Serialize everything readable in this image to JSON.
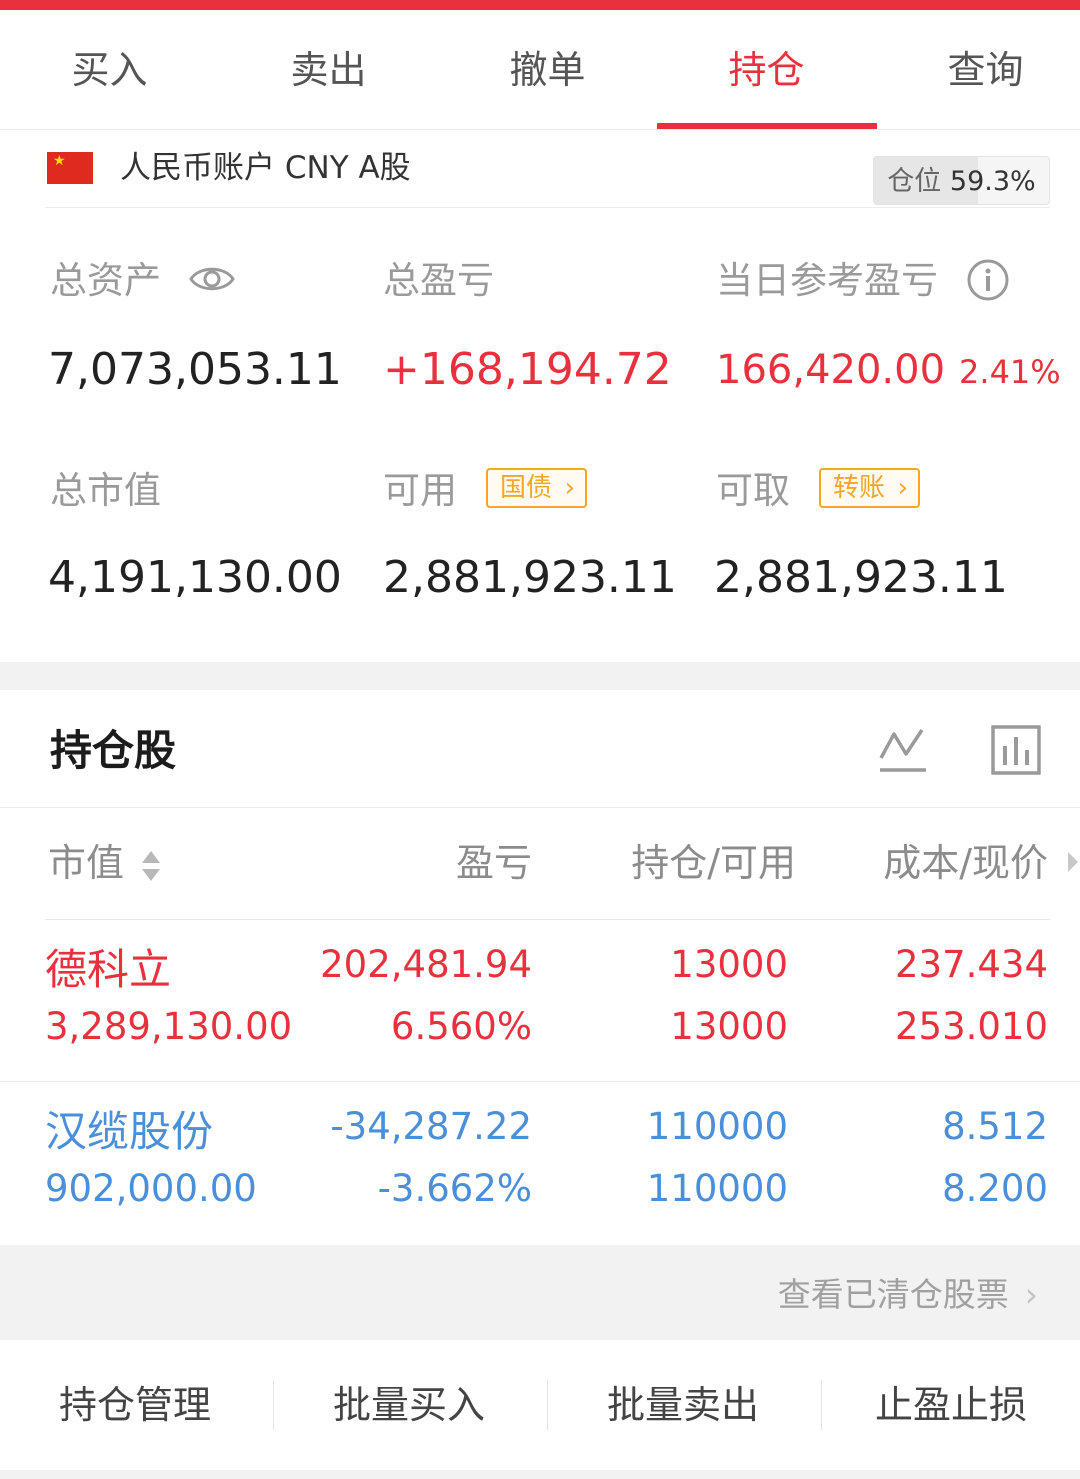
{
  "theme": {
    "accent": "#e8313c",
    "down_color": "#4a8fd9",
    "tag_color": "#f5a623"
  },
  "tabs": [
    {
      "label": "买入",
      "active": false
    },
    {
      "label": "卖出",
      "active": false
    },
    {
      "label": "撤单",
      "active": false
    },
    {
      "label": "持仓",
      "active": true
    },
    {
      "label": "查询",
      "active": false
    }
  ],
  "account": {
    "flag_icon": "china-flag-icon",
    "name": "人民币账户 CNY A股",
    "position_label": "仓位",
    "position_value": "59.3%",
    "position_fraction": 0.593
  },
  "summary": {
    "total_assets": {
      "label": "总资产",
      "value": "7,073,053.11",
      "icon": "eye-icon"
    },
    "total_pnl": {
      "label": "总盈亏",
      "value": "+168,194.72"
    },
    "daily_pnl": {
      "label": "当日参考盈亏",
      "value": "166,420.00",
      "pct": "2.41%",
      "icon": "info-icon"
    },
    "market_value": {
      "label": "总市值",
      "value": "4,191,130.00"
    },
    "available": {
      "label": "可用",
      "tag": "国债",
      "value": "2,881,923.11"
    },
    "withdrawable": {
      "label": "可取",
      "tag": "转账",
      "value": "2,881,923.11"
    }
  },
  "holdings": {
    "title": "持仓股",
    "columns": {
      "market_value": "市值",
      "pnl": "盈亏",
      "qty": "持仓/可用",
      "price": "成本/现价"
    },
    "rows": [
      {
        "name": "德科立",
        "market_value": "3,289,130.00",
        "pnl": "202,481.94",
        "pnl_pct": "6.560%",
        "position": "13000",
        "available": "13000",
        "cost": "237.434",
        "price": "253.010",
        "direction": "up"
      },
      {
        "name": "汉缆股份",
        "market_value": "902,000.00",
        "pnl": "-34,287.22",
        "pnl_pct": "-3.662%",
        "position": "110000",
        "available": "110000",
        "cost": "8.512",
        "price": "8.200",
        "direction": "down"
      }
    ]
  },
  "cleared_link": "查看已清仓股票",
  "actions": [
    "持仓管理",
    "批量买入",
    "批量卖出",
    "止盈止损"
  ]
}
